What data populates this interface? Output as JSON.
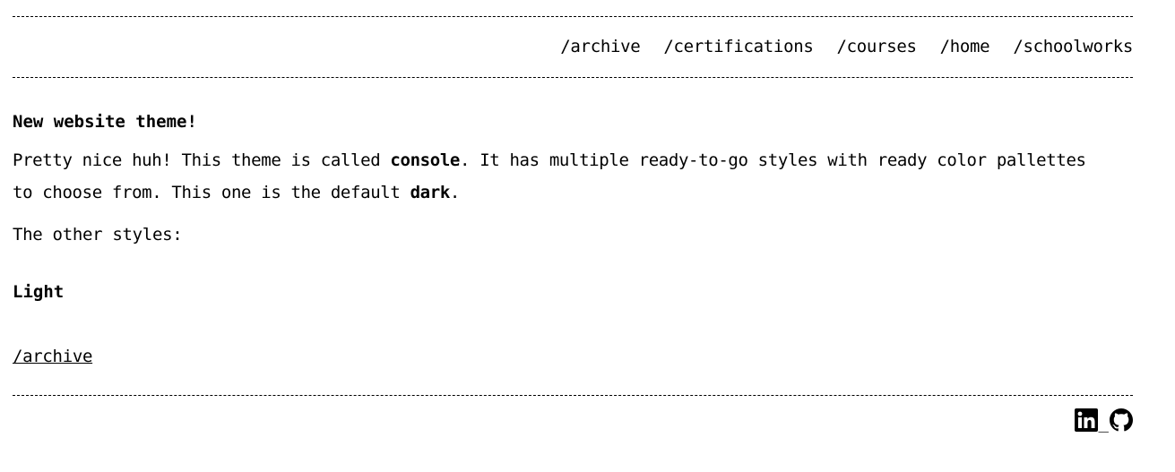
{
  "nav": {
    "items": [
      "/archive",
      "/certifications",
      "/courses",
      "/home",
      "/schoolworks"
    ]
  },
  "post": {
    "title": "New website theme!",
    "para_before_console": "Pretty nice huh! This theme is called ",
    "console_word": "console",
    "para_after_console": ". It has multiple ready-to-go styles with ready color pallettes to choose from. This one is the default ",
    "dark_word": "dark",
    "para_end": ".",
    "other_styles": "The other styles:",
    "style_heading": "Light"
  },
  "footer": {
    "back_link": "/archive",
    "separator": "_",
    "icons": [
      "linkedin-icon",
      "github-icon"
    ]
  },
  "colors": {
    "background": "#ffffff",
    "text": "#000000"
  }
}
